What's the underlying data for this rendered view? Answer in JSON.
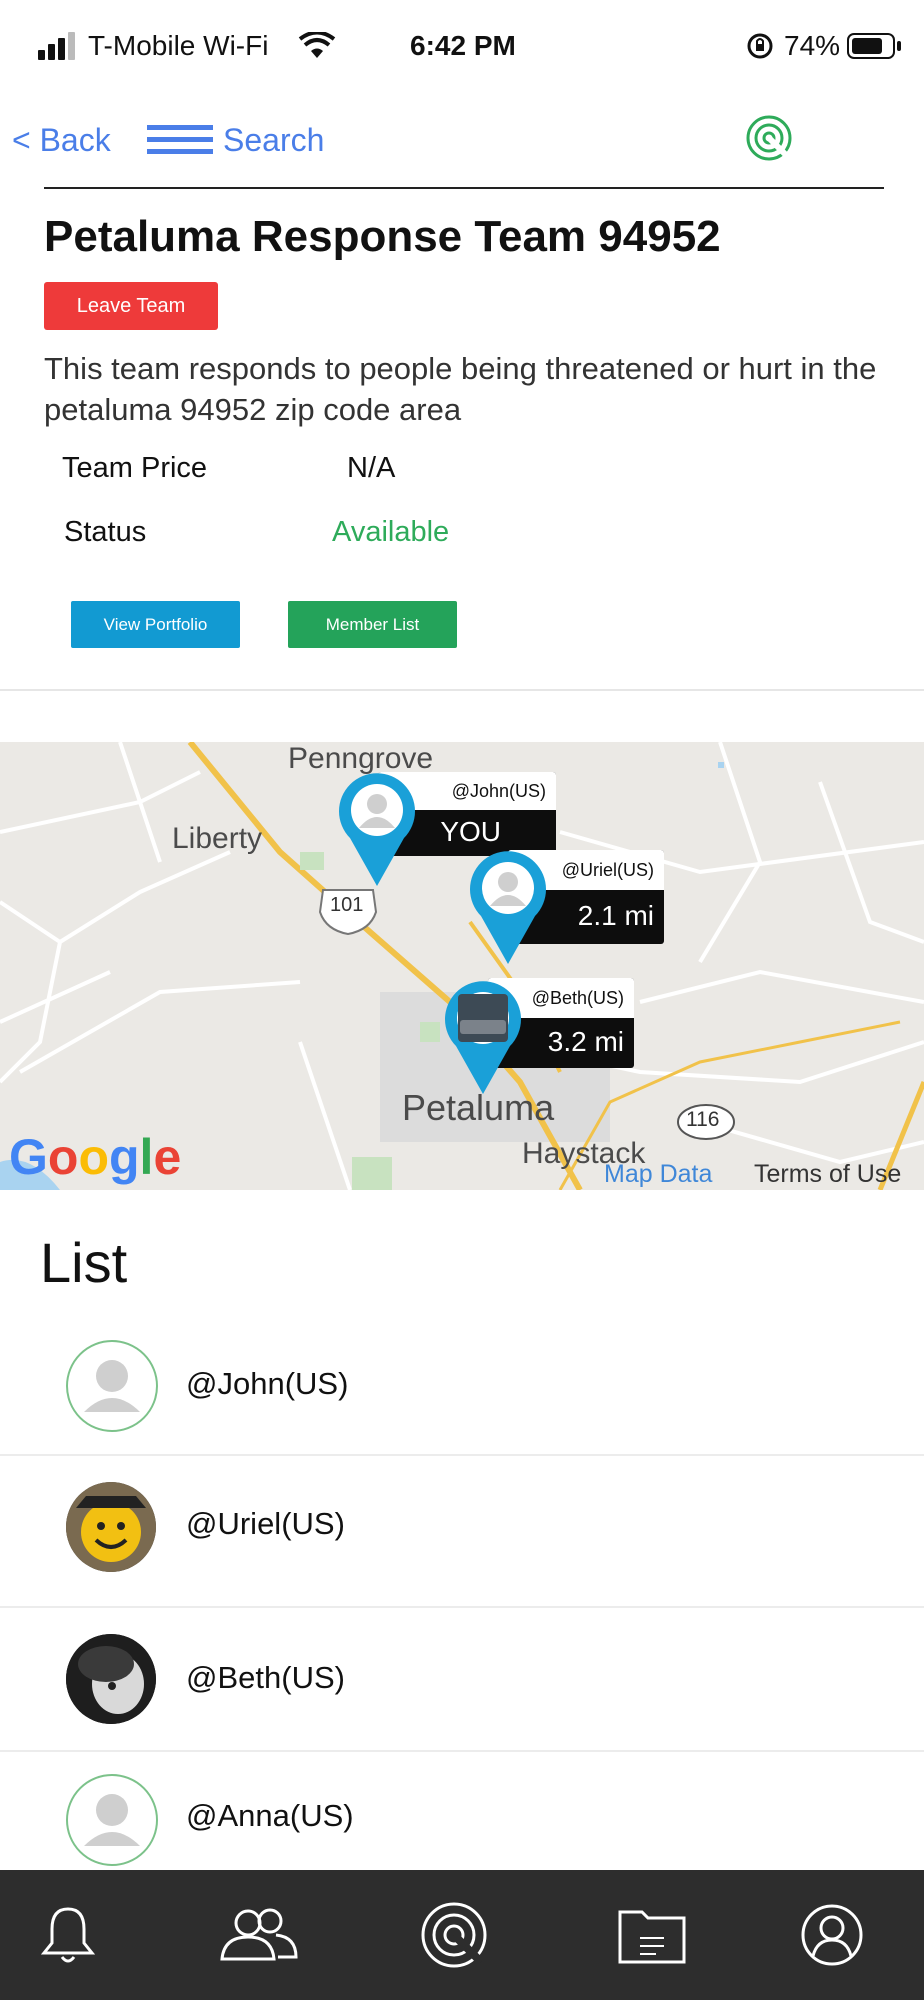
{
  "status_bar": {
    "carrier": "T-Mobile Wi-Fi",
    "time": "6:42 PM",
    "battery": "74%"
  },
  "nav": {
    "back_label": "< Back",
    "search_label": "Search",
    "menu_icon": "hamburger-icon",
    "logo_icon": "radar-logo-icon"
  },
  "team": {
    "title": "Petaluma Response Team 94952",
    "leave_label": "Leave Team",
    "description": "This team responds to people being threatened or hurt in the petaluma 94952 zip code area",
    "price_label": "Team Price",
    "price_value": "N/A",
    "status_label": "Status",
    "status_value": "Available",
    "portfolio_label": "View  Portfolio",
    "members_label": "Member List"
  },
  "map": {
    "places": [
      "Penngrove",
      "Liberty",
      "Petaluma",
      "Haystack"
    ],
    "highway_shields": [
      "101",
      "116"
    ],
    "pins": [
      {
        "handle": "@John(US)",
        "value": "YOU"
      },
      {
        "handle": "@Uriel(US)",
        "value": "2.1 mi"
      },
      {
        "handle": "@Beth(US)",
        "value": "3.2 mi"
      }
    ],
    "map_data_label": "Map Data",
    "terms_label": "Terms of Use",
    "attribution": "Google",
    "pin_color": "#1aa0d8"
  },
  "list": {
    "title": "List",
    "items": [
      {
        "name": "@John(US)"
      },
      {
        "name": "@Uriel(US)"
      },
      {
        "name": "@Beth(US)"
      },
      {
        "name": "@Anna(US)"
      }
    ]
  },
  "tab_bar": {
    "icons": [
      "bell-icon",
      "people-icon",
      "radar-icon",
      "folder-icon",
      "profile-icon"
    ]
  },
  "colors": {
    "accent_blue": "#4a7ee8",
    "leave_red": "#ee3a3a",
    "available_green": "#2eab5a",
    "portfolio_blue": "#129ad2",
    "member_green": "#24a35a",
    "tab_bar_bg": "#2d2d2d"
  }
}
